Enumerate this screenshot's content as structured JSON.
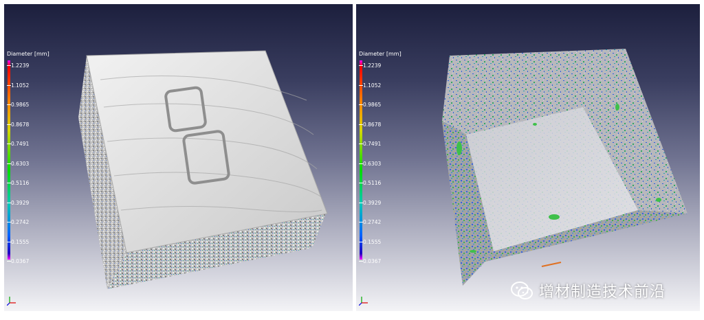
{
  "left_view": {
    "legend_title": "Diameter [mm]",
    "ticks": [
      "1.2239",
      "1.1052",
      "0.9865",
      "0.8678",
      "0.7491",
      "0.6303",
      "0.5116",
      "0.3929",
      "0.2742",
      "0.1555",
      "0.0367"
    ]
  },
  "right_view": {
    "legend_title": "Diameter [mm]",
    "ticks": [
      "1.2239",
      "1.1052",
      "0.9865",
      "0.8678",
      "0.7491",
      "0.6303",
      "0.5116",
      "0.3929",
      "0.2742",
      "0.1555",
      "0.0367"
    ]
  },
  "watermark": {
    "text": "增材制造技术前沿"
  },
  "colors": {
    "legend_max": "#ff00ff",
    "legend_min": "#2000c0",
    "surface": "#d8d8d8"
  }
}
